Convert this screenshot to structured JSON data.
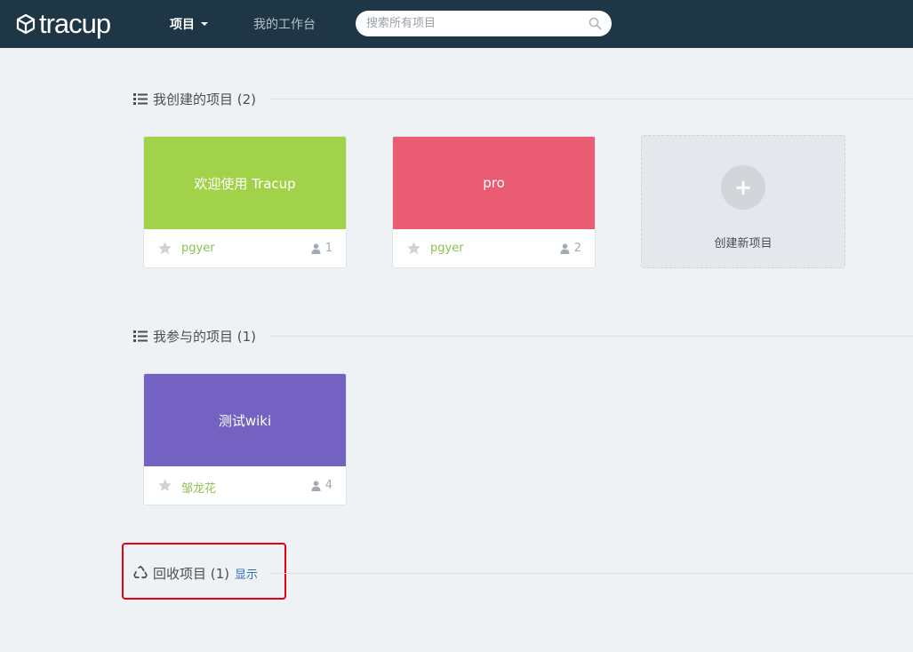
{
  "header": {
    "logo_text": "tracup",
    "nav_projects": "项目",
    "nav_workbench": "我的工作台",
    "search_placeholder": "搜索所有项目"
  },
  "sections": {
    "created": {
      "title": "我创建的项目 (2)",
      "projects": [
        {
          "name": "欢迎使用 Tracup",
          "owner": "pgyer",
          "members": "1",
          "color": "#a2d14a"
        },
        {
          "name": "pro",
          "owner": "pgyer",
          "members": "2",
          "color": "#e95c73"
        }
      ],
      "create_label": "创建新项目",
      "create_symbol": "+"
    },
    "joined": {
      "title": "我参与的项目 (1)",
      "projects": [
        {
          "name": "测试wiki",
          "owner": "邹龙花",
          "members": "4",
          "color": "#7462c3"
        }
      ]
    },
    "recycle": {
      "title": "回收项目 (1)",
      "show_label": "显示"
    }
  },
  "colors": {
    "topbar": "#1f3647",
    "owner_text": "#8cc152",
    "link": "#2a6cbf",
    "highlight_box": "#e60012"
  }
}
